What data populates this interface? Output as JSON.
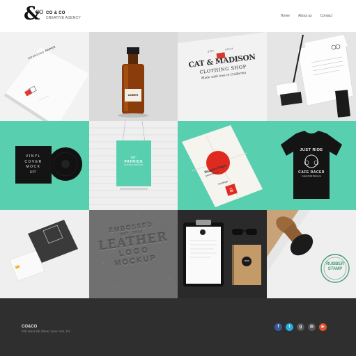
{
  "brand": {
    "mark": "&",
    "mark_small": "CO",
    "name": "CO & CO",
    "tagline": "CREATIVE AGENCY"
  },
  "nav": [
    {
      "label": "Home"
    },
    {
      "label": "About us"
    },
    {
      "label": "Contact"
    }
  ],
  "portfolio": {
    "tiles": [
      {
        "name": "branding-paper",
        "bg": "#f0f0f0",
        "text": [
          "BRANDING",
          "PAPER"
        ]
      },
      {
        "name": "amber-bottle",
        "bg": "#d9d9d9",
        "text": [
          "AMBER"
        ]
      },
      {
        "name": "cat-madison",
        "bg": "#ececec",
        "text": [
          "EST.",
          "2014",
          "CAT & MADISON",
          "CLOTHING SHOP",
          "Made with love in California"
        ]
      },
      {
        "name": "stationery",
        "bg": "#e4e4e4",
        "text": []
      },
      {
        "name": "vinyl-cover",
        "bg": "#5ad0b0",
        "text": [
          "VINYL",
          "COVER",
          "MOCK",
          "UP"
        ]
      },
      {
        "name": "poster-brick",
        "bg": "#eeeeee",
        "text": [
          "Mr.",
          "PATRICK",
          "POSTER MOCKUP"
        ]
      },
      {
        "name": "folded-poster",
        "bg": "#5ad0b0",
        "text": [
          "Reason Paper",
          "presentation",
          "mockup",
          "Vol.",
          "05"
        ]
      },
      {
        "name": "tshirt",
        "bg": "#5ad0b0",
        "text": [
          "JUST RIDE",
          "CAFE RACER",
          "Custom Build Motorcycle"
        ]
      },
      {
        "name": "business-cards",
        "bg": "#eeeeee",
        "text": []
      },
      {
        "name": "embossed-leather",
        "bg": "#6f6f6f",
        "text": [
          "EMBOSSED",
          "EST. 2014",
          "LEATHER",
          "LOGO",
          "MOCKUP"
        ]
      },
      {
        "name": "clipboard",
        "bg": "#2b2b2b",
        "text": [
          "LOGO"
        ]
      },
      {
        "name": "rubber-stamp",
        "bg": "#ededed",
        "text": [
          "RUBBER",
          "STAMP"
        ]
      }
    ]
  },
  "footer": {
    "name": "CO&CO",
    "address": "208 West 8th Street, New York, NY",
    "social": [
      {
        "icon": "facebook-icon",
        "glyph": "f",
        "color": "#3b5998"
      },
      {
        "icon": "twitter-icon",
        "glyph": "t",
        "color": "#29a9e0"
      },
      {
        "icon": "google-plus-icon",
        "glyph": "g",
        "color": "#555555"
      },
      {
        "icon": "instagram-icon",
        "glyph": "◎",
        "color": "#555555"
      },
      {
        "icon": "youtube-icon",
        "glyph": "▶",
        "color": "#e0542f"
      }
    ]
  }
}
